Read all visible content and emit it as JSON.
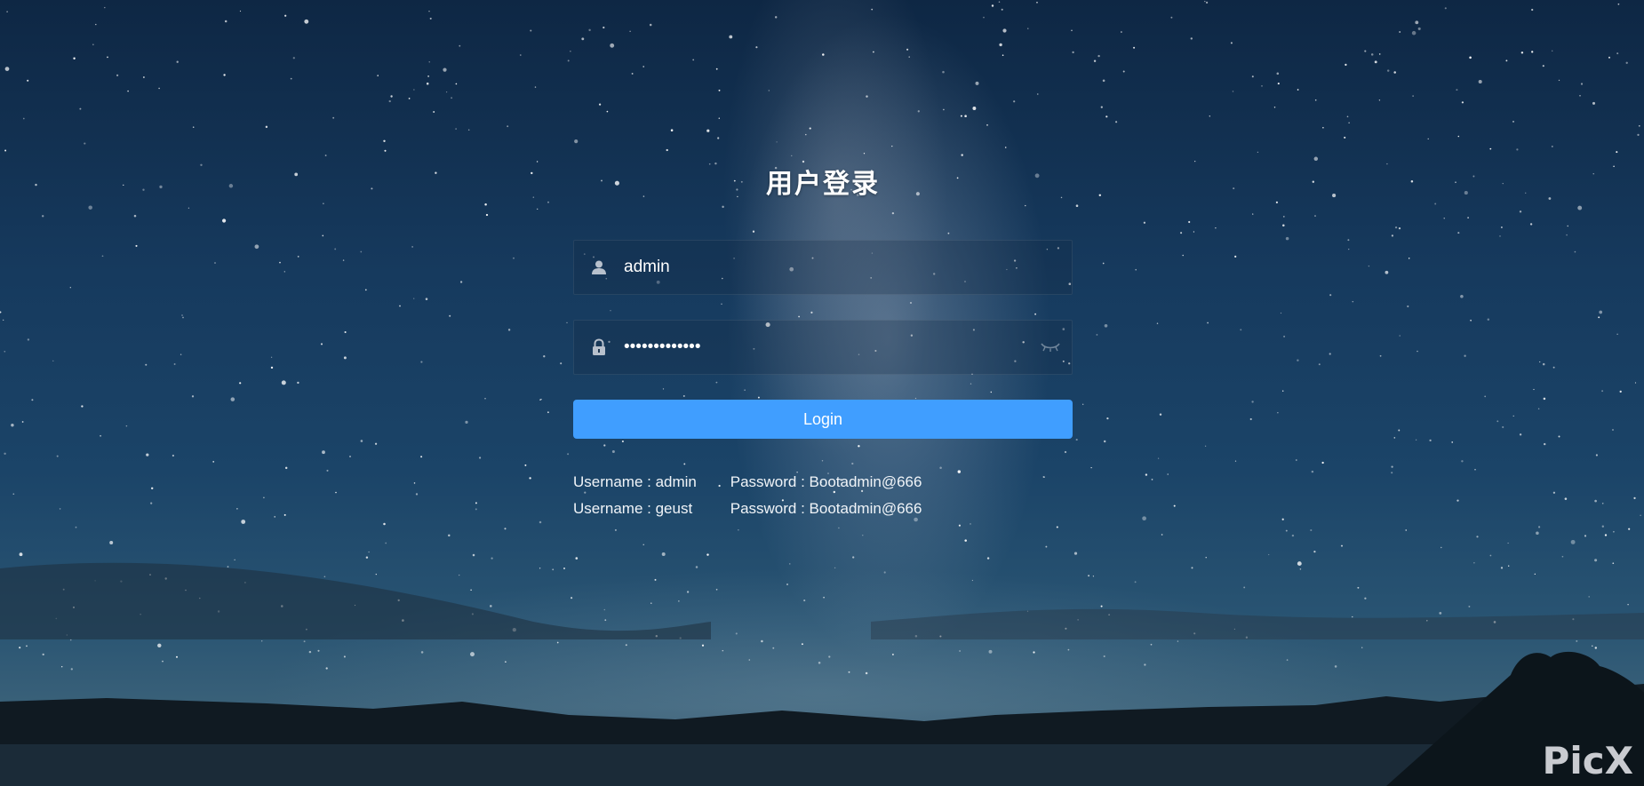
{
  "login": {
    "title": "用户登录",
    "username_value": "admin",
    "password_value": "•••••••••••••",
    "button_label": "Login"
  },
  "hints": [
    {
      "username": "Username : admin",
      "password": "Password : Bootadmin@666"
    },
    {
      "username": "Username : geust",
      "password": "Password : Bootadmin@666"
    }
  ],
  "watermark": "PicX",
  "colors": {
    "button": "#409eff",
    "sky_top": "#0e2744",
    "sky_bottom": "#2b4a60"
  },
  "icons": {
    "username": "user-icon",
    "password": "lock-icon",
    "toggle": "eye-closed-icon"
  }
}
